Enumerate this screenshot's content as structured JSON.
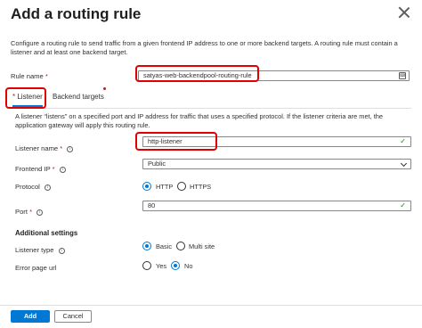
{
  "header": {
    "title": "Add a routing rule"
  },
  "description": "Configure a routing rule to send traffic from a given frontend IP address to one or more backend targets. A routing rule must contain a listener and at least one backend target.",
  "rule_name": {
    "label": "Rule name",
    "required_mark": "*",
    "value": "satyas-web-backendpool-routing-rule"
  },
  "tabs": [
    {
      "label": "Listener",
      "required_mark": "*",
      "selected": true
    },
    {
      "label": "Backend targets",
      "selected": false
    }
  ],
  "listener_description": "A listener “listens” on a specified port and IP address for traffic that uses a specified protocol. If the listener criteria are met, the application gateway will apply this routing rule.",
  "listener_name": {
    "label": "Listener name",
    "required_mark": "*",
    "value": "http-listener"
  },
  "frontend_ip": {
    "label": "Frontend IP",
    "required_mark": "*",
    "value": "Public"
  },
  "protocol": {
    "label": "Protocol",
    "options": [
      "HTTP",
      "HTTPS"
    ],
    "selected": "HTTP"
  },
  "port": {
    "label": "Port",
    "required_mark": "*",
    "value": "80"
  },
  "additional_settings": {
    "title": "Additional settings",
    "listener_type": {
      "label": "Listener type",
      "options": [
        "Basic",
        "Multi site"
      ],
      "selected": "Basic"
    },
    "error_page_url": {
      "label": "Error page url",
      "options": [
        "Yes",
        "No"
      ],
      "selected": "No"
    }
  },
  "footer": {
    "add_label": "Add",
    "cancel_label": "Cancel"
  },
  "colors": {
    "accent": "#0078d4",
    "highlight_box": "#e00000",
    "valid_check": "#107c10"
  },
  "icons": {
    "close": "close-icon",
    "info": "info-icon",
    "check": "checkmark-icon",
    "chevron": "chevron-down-icon",
    "keyboard": "keyboard-icon"
  }
}
